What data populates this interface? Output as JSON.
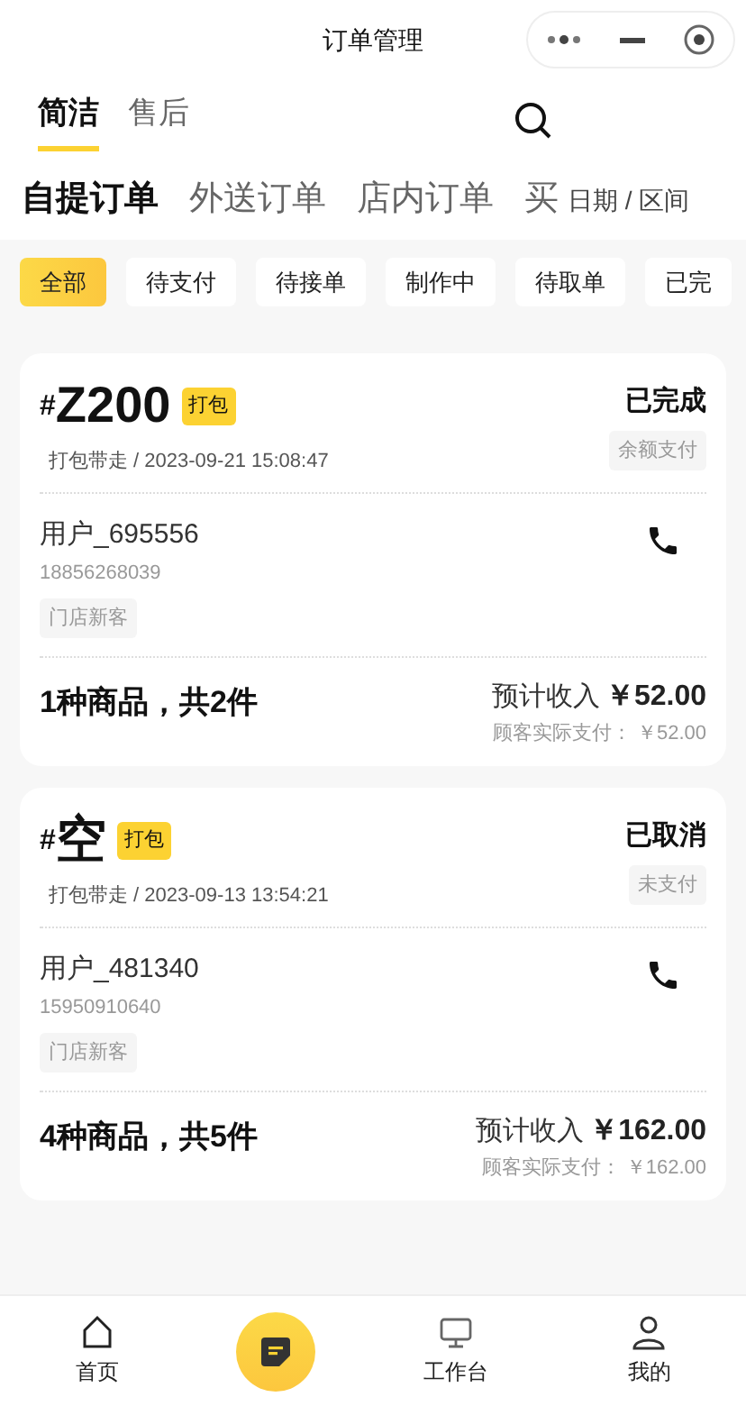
{
  "window": {
    "title": "订单管理"
  },
  "view_tabs": [
    {
      "label": "简洁",
      "selected": true
    },
    {
      "label": "售后",
      "selected": false
    }
  ],
  "order_types": [
    {
      "label": "自提订单",
      "selected": true
    },
    {
      "label": "外送订单",
      "selected": false
    },
    {
      "label": "店内订单",
      "selected": false
    },
    {
      "label": "买",
      "selected": false
    }
  ],
  "date_filter": "日期 / 区间",
  "status_filters": [
    {
      "label": "全部",
      "selected": true
    },
    {
      "label": "待支付",
      "selected": false
    },
    {
      "label": "待接单",
      "selected": false
    },
    {
      "label": "制作中",
      "selected": false
    },
    {
      "label": "待取单",
      "selected": false
    },
    {
      "label": "已完",
      "selected": false
    }
  ],
  "orders": [
    {
      "hash": "#",
      "number": "Z200",
      "tag": "打包",
      "meta": "打包带走 / 2023-09-21 15:08:47",
      "status": "已完成",
      "payment": "余额支付",
      "user": "用户_695556",
      "phone": "18856268039",
      "customer_tag": "门店新客",
      "items": "1种商品，共2件",
      "income_label": "预计收入",
      "income": "￥52.00",
      "paid": "顾客实际支付： ￥52.00"
    },
    {
      "hash": "#",
      "number": "空",
      "tag": "打包",
      "meta": "打包带走 / 2023-09-13 13:54:21",
      "status": "已取消",
      "payment": "未支付",
      "user": "用户_481340",
      "phone": "15950910640",
      "customer_tag": "门店新客",
      "items": "4种商品，共5件",
      "income_label": "预计收入",
      "income": "￥162.00",
      "paid": "顾客实际支付： ￥162.00"
    }
  ],
  "nav": [
    {
      "kind": "home",
      "label": "首页"
    },
    {
      "kind": "center"
    },
    {
      "kind": "desk",
      "label": "工作台"
    },
    {
      "kind": "user",
      "label": "我的"
    }
  ]
}
